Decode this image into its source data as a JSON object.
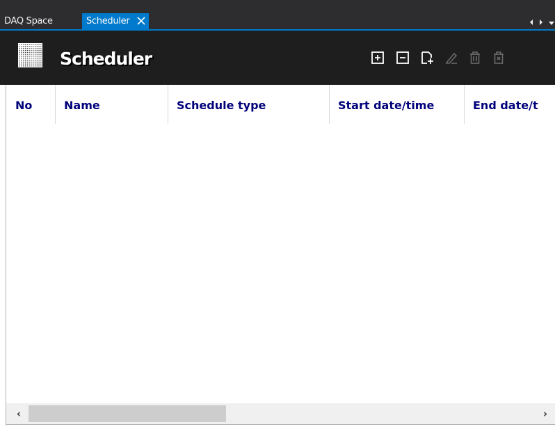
{
  "tabs": [
    {
      "label": "DAQ Space",
      "active": false
    },
    {
      "label": "Scheduler",
      "active": true
    }
  ],
  "header": {
    "title": "Scheduler",
    "toolbar": [
      {
        "icon": "add-icon",
        "enabled": true
      },
      {
        "icon": "remove-icon",
        "enabled": true
      },
      {
        "icon": "new-document-icon",
        "enabled": true
      },
      {
        "icon": "edit-icon",
        "enabled": false
      },
      {
        "icon": "delete-icon",
        "enabled": false
      },
      {
        "icon": "delete-calendar-icon",
        "enabled": false
      }
    ]
  },
  "table": {
    "columns": [
      "No",
      "Name",
      "Schedule type",
      "Start date/time",
      "End date/t"
    ],
    "rows": []
  },
  "colors": {
    "accent": "#007acc",
    "header_bg": "#1e1e1e",
    "tabbar_bg": "#2d2d30",
    "column_text": "#00007a"
  }
}
